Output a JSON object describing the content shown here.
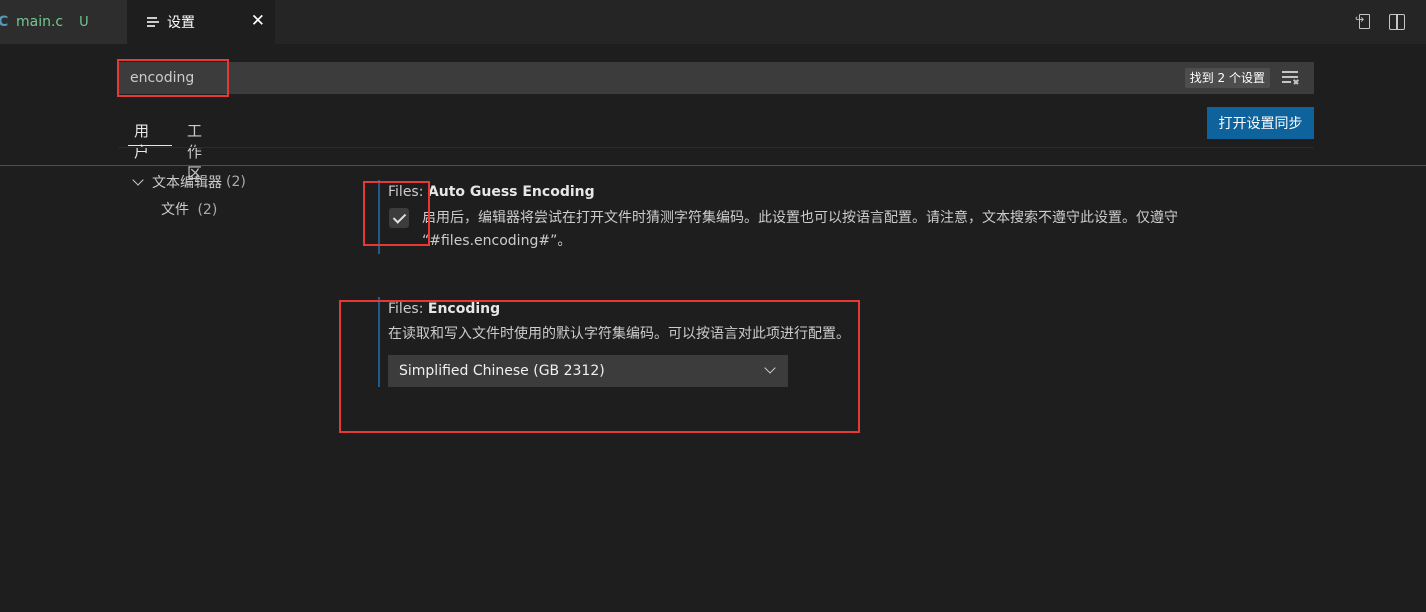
{
  "tabs": {
    "main": {
      "lang_icon": "C",
      "label": "main.c",
      "git_status": "U"
    },
    "settings": {
      "icon": "settings-list-icon",
      "label": "设置",
      "close": "✕"
    }
  },
  "actions": {
    "open_json": "open-settings-json-icon",
    "split": "split-editor-icon",
    "more": "more-icon"
  },
  "search": {
    "value": "encoding",
    "results_badge": "找到 2 个设置",
    "filter_icon": "filter-icon"
  },
  "scopes": {
    "user": "用户",
    "workspace": "工作区"
  },
  "sync_button": "打开设置同步",
  "toc": {
    "group_label": "文本编辑器",
    "group_count": "(2)",
    "item_label": "文件",
    "item_count": "(2)"
  },
  "settings": [
    {
      "category": "Files: ",
      "name": "Auto Guess Encoding",
      "description": "启用后，编辑器将尝试在打开文件时猜测字符集编码。此设置也可以按语言配置。请注意，文本搜索不遵守此设置。仅遵守 “#files.encoding#”。",
      "checked": true
    },
    {
      "category": "Files: ",
      "name": "Encoding",
      "description": "在读取和写入文件时使用的默认字符集编码。可以按语言对此项进行配置。",
      "selected": "Simplified Chinese (GB 2312)"
    }
  ],
  "colors": {
    "accent": "#0e639c",
    "annotation": "#e53935",
    "untracked": "#73c991"
  }
}
